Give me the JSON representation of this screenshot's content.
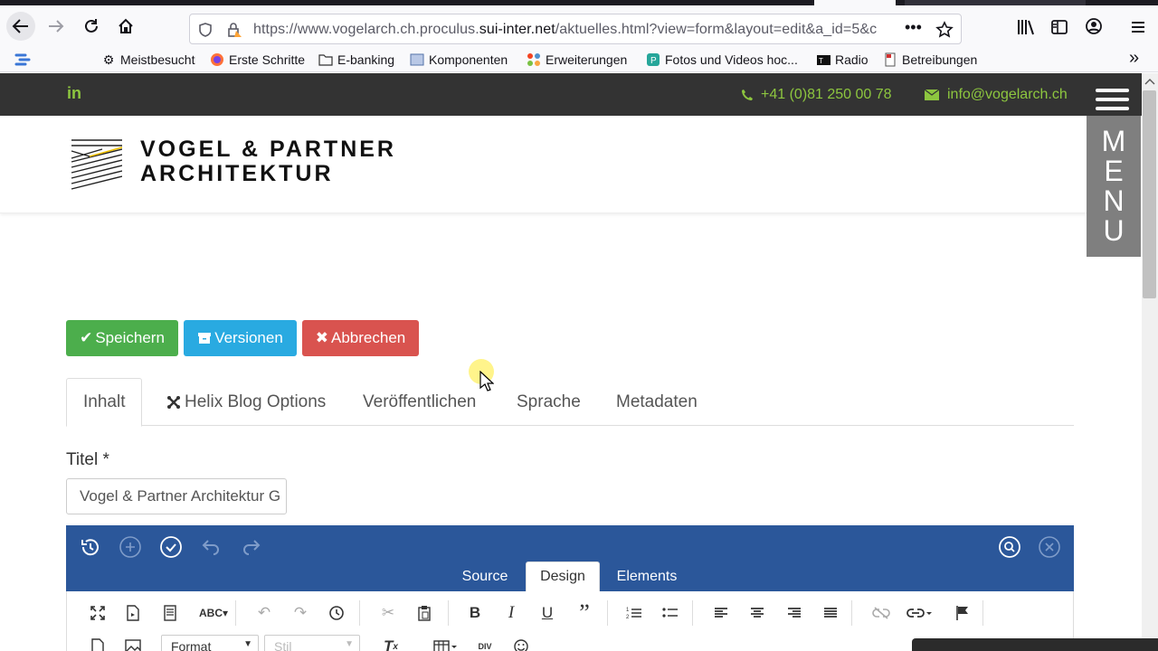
{
  "browser": {
    "url_prefix": "https://www.vogelarch.ch.proculus.",
    "url_domain": "sui-inter.net",
    "url_suffix": "/aktuelles.html?view=form&layout=edit&a_id=5&c",
    "bookmarks": [
      {
        "label": "Meistbesucht",
        "icon": "gear-icon"
      },
      {
        "label": "Erste Schritte",
        "icon": "firefox-icon"
      },
      {
        "label": "E-banking",
        "icon": "folder-icon"
      },
      {
        "label": "Komponenten",
        "icon": "component-icon"
      },
      {
        "label": "Erweiterungen",
        "icon": "joomla-icon"
      },
      {
        "label": "Fotos und Videos hoc...",
        "icon": "photo-icon"
      },
      {
        "label": "Radio",
        "icon": "radio-icon"
      },
      {
        "label": "Betreibungen",
        "icon": "doc-icon"
      }
    ]
  },
  "site": {
    "phone": "+41 (0)81 250 00 78",
    "email": "info@vogelarch.ch",
    "logo_line1": "VOGEL & PARTNER",
    "logo_line2": "ARCHITEKTUR",
    "menu_letters": [
      "M",
      "E",
      "N",
      "U"
    ],
    "accent": "#8dc63f"
  },
  "form": {
    "buttons": {
      "save": "Speichern",
      "versions": "Versionen",
      "cancel": "Abbrechen"
    },
    "tabs": [
      "Inhalt",
      "Helix Blog Options",
      "Veröffentlichen",
      "Sprache",
      "Metadaten"
    ],
    "title_label": "Titel *",
    "title_value": "Vogel & Partner Architektur G"
  },
  "editor": {
    "tabs": [
      "Source",
      "Design",
      "Elements"
    ],
    "format_label": "Format",
    "style_label": "Stil"
  }
}
